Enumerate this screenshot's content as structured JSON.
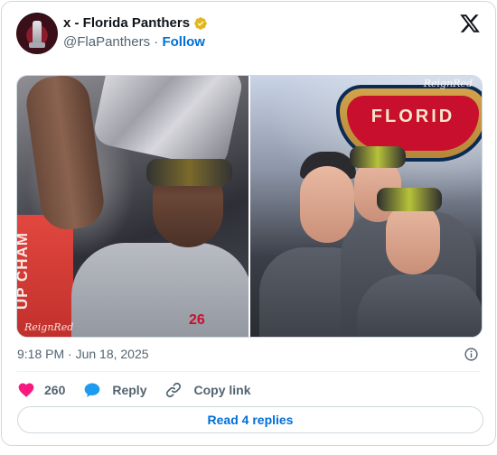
{
  "author": {
    "name": "x - Florida Panthers",
    "handle": "@FlaPanthers",
    "separator": "·",
    "follow_label": "Follow"
  },
  "media": {
    "left_watermark": "ReignRed",
    "right_watermark": "ReignRed",
    "left_banner_text": "UP CHAM",
    "left_jersey_number": "26",
    "right_logo_text": "FLORID"
  },
  "meta": {
    "timestamp": "9:18 PM · Jun 18, 2025"
  },
  "actions": {
    "like_count": "260",
    "reply_label": "Reply",
    "copy_label": "Copy link"
  },
  "footer": {
    "read_replies_label": "Read 4 replies"
  },
  "colors": {
    "link_blue": "#006fd6",
    "like_pink": "#f91880",
    "reply_blue": "#1d9bf0",
    "verified_gold": "#e2b719",
    "muted_text": "#536471"
  },
  "icons": {
    "brand": "x-logo-icon",
    "verified": "verified-badge-icon",
    "info": "info-icon",
    "like": "heart-icon",
    "reply": "speech-bubble-icon",
    "copy": "link-icon"
  }
}
